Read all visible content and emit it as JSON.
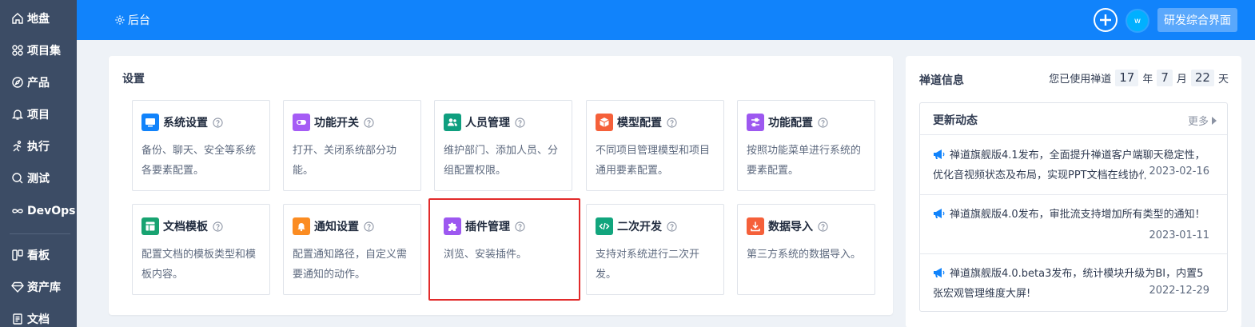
{
  "sidebar": {
    "items": [
      {
        "label": "地盘",
        "icon": "home-icon"
      },
      {
        "label": "项目集",
        "icon": "grid-icon"
      },
      {
        "label": "产品",
        "icon": "compass-icon"
      },
      {
        "label": "项目",
        "icon": "bell-icon"
      },
      {
        "label": "执行",
        "icon": "run-icon"
      },
      {
        "label": "测试",
        "icon": "search-icon"
      },
      {
        "label": "DevOps",
        "icon": "infinity-icon"
      },
      {
        "label": "看板",
        "icon": "kanban-icon"
      },
      {
        "label": "资产库",
        "icon": "diamond-icon"
      },
      {
        "label": "文档",
        "icon": "doc-icon"
      }
    ]
  },
  "header": {
    "back_label": "后台",
    "avatar_text": "w",
    "app_label": "研发综合界面",
    "bg_color": "#1183fb"
  },
  "settings": {
    "title": "设置",
    "cards": [
      {
        "name": "系统设置",
        "desc": "备份、聊天、安全等系统各要素配置。",
        "icon": "monitor-icon",
        "color": "#1183fb"
      },
      {
        "name": "功能开关",
        "desc": "打开、关闭系统部分功能。",
        "icon": "toggle-icon",
        "color": "#a55cf5"
      },
      {
        "name": "人员管理",
        "desc": "维护部门、添加人员、分组配置权限。",
        "icon": "users-icon",
        "color": "#0f9f7f"
      },
      {
        "name": "模型配置",
        "desc": "不同项目管理模型和项目通用要素配置。",
        "icon": "cube-icon",
        "color": "#f5603a"
      },
      {
        "name": "功能配置",
        "desc": "按照功能菜单进行系统的要素配置。",
        "icon": "sliders-icon",
        "color": "#9d58f0"
      },
      {
        "name": "文档模板",
        "desc": "配置文档的模板类型和模板内容。",
        "icon": "template-icon",
        "color": "#18a371"
      },
      {
        "name": "通知设置",
        "desc": "配置通知路径，自定义需要通知的动作。",
        "icon": "bell-icon",
        "color": "#fb8c22"
      },
      {
        "name": "插件管理",
        "desc": "浏览、安装插件。",
        "icon": "puzzle-icon",
        "color": "#9d58f0"
      },
      {
        "name": "二次开发",
        "desc": "支持对系统进行二次开发。",
        "icon": "code-icon",
        "color": "#12a57d"
      },
      {
        "name": "数据导入",
        "desc": "第三方系统的数据导入。",
        "icon": "download-icon",
        "color": "#f5603a"
      }
    ]
  },
  "info": {
    "title": "禅道信息",
    "usage_prefix": "您已使用禅道",
    "years": "17",
    "year_unit": "年",
    "months": "7",
    "month_unit": "月",
    "days": "22",
    "day_unit": "天",
    "news_title": "更新动态",
    "more_label": "更多",
    "news": [
      {
        "text": "禅道旗舰版4.1发布，全面提升禅道客户端聊天稳定性，优化音视频状态及布局，实现PPT文档在线协作",
        "date": "2023-02-16"
      },
      {
        "text": "禅道旗舰版4.0发布，审批流支持增加所有类型的通知！",
        "date": "2023-01-11"
      },
      {
        "text": "禅道旗舰版4.0.beta3发布，统计模块升级为BI，内置5张宏观管理维度大屏!",
        "date": "2022-12-29"
      }
    ]
  }
}
